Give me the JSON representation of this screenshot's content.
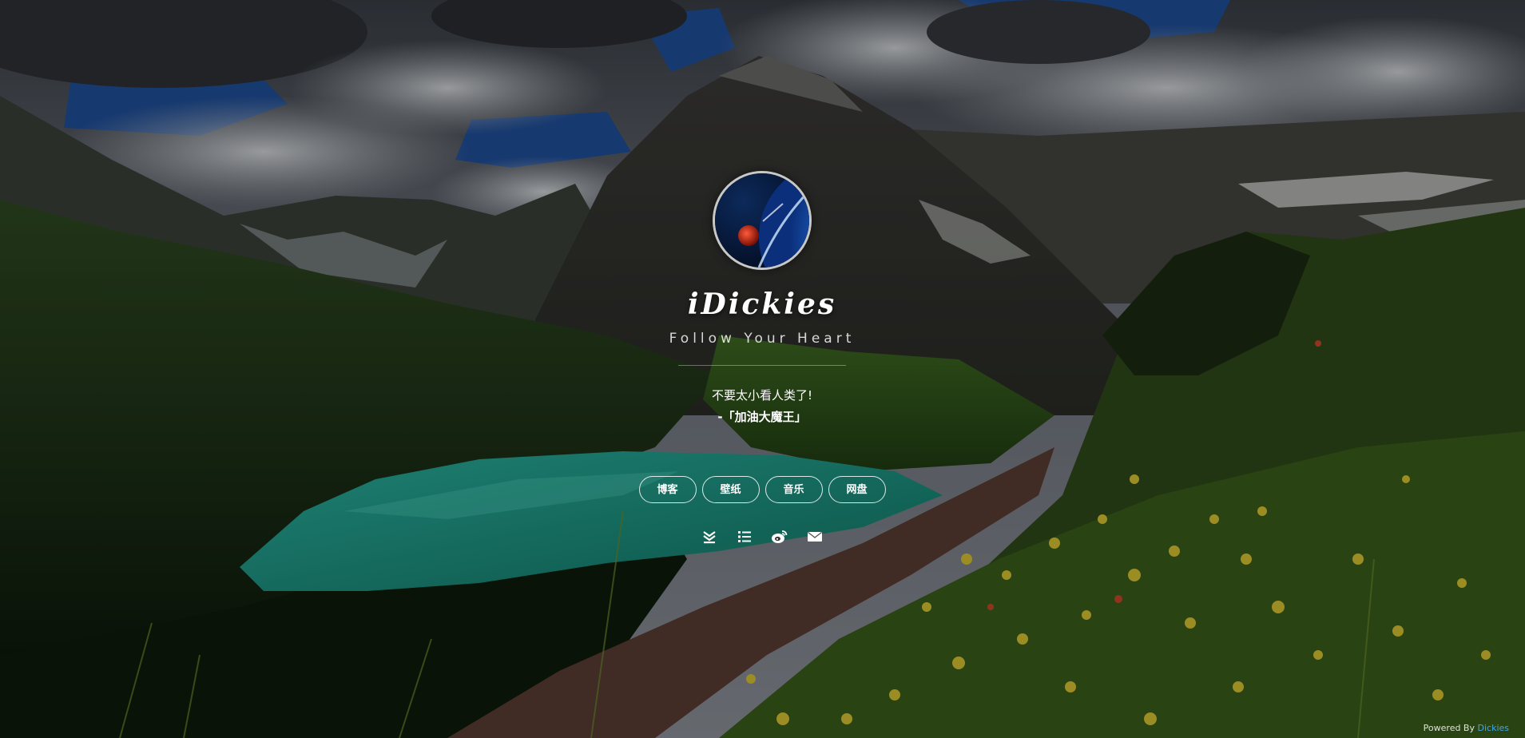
{
  "site": {
    "title": "iDickies",
    "tagline": "Follow Your Heart"
  },
  "quote": {
    "text": "不要太小看人类了!",
    "author": "-「加油大魔王」"
  },
  "nav": {
    "items": [
      {
        "label": "博客"
      },
      {
        "label": "壁纸"
      },
      {
        "label": "音乐"
      },
      {
        "label": "网盘"
      }
    ]
  },
  "social_icons": [
    "layers-icon",
    "list-icon",
    "weibo-icon",
    "mail-icon"
  ],
  "footer": {
    "prefix": "Powered By ",
    "link": "Dickies"
  },
  "colors": {
    "footer_link": "#3fa7e6",
    "lake": "#1e9a8a"
  }
}
